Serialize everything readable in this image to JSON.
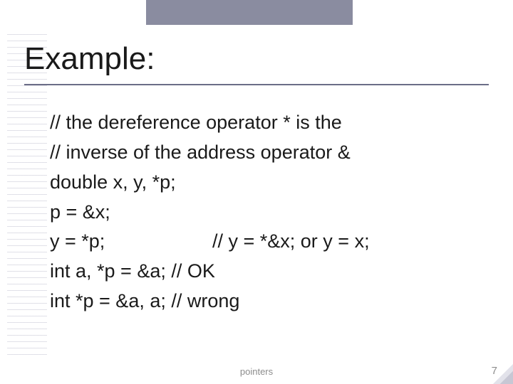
{
  "title": "Example:",
  "code": {
    "l1": "// the dereference operator * is the",
    "l2": "// inverse of the address operator &",
    "l3": "double x, y, *p;",
    "l4": "p = &x;",
    "l5a": "y = *p;",
    "l5b": "// y = *&x; or y = x;",
    "l6": "int a, *p = &a; // OK",
    "l7": "int *p = &a, a; // wrong"
  },
  "footer": {
    "center": "pointers",
    "page": "7"
  }
}
